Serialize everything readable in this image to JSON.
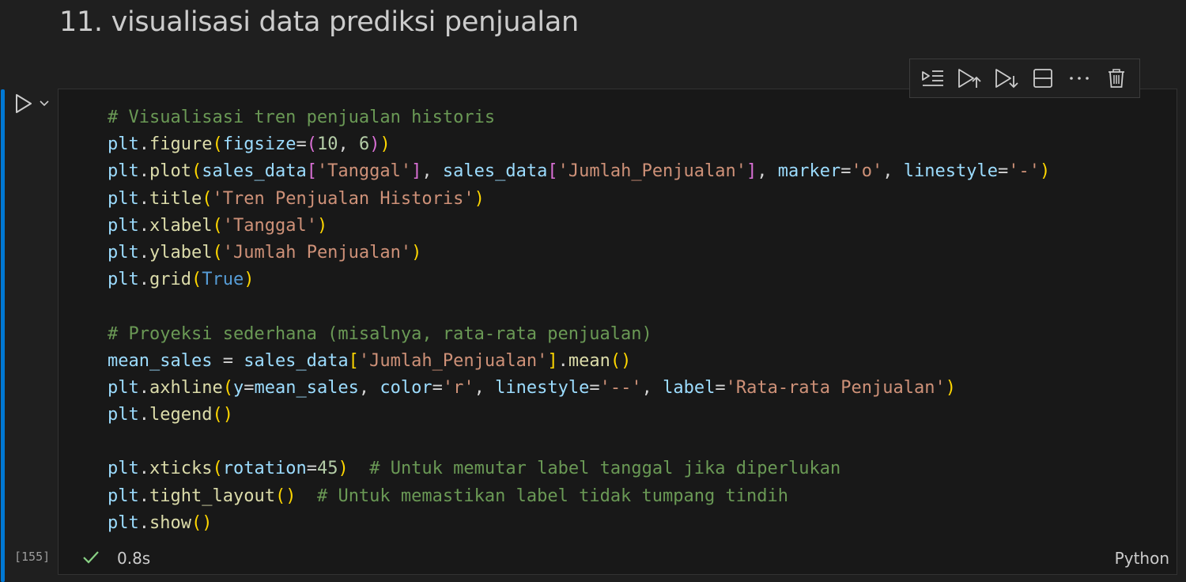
{
  "markdown": {
    "heading": "11. visualisasi data prediksi penjualan"
  },
  "cell": {
    "execution_count": "[155]",
    "duration": "0.8s",
    "language": "Python",
    "status": "success",
    "code_lines": [
      "# Visualisasi tren penjualan historis",
      "plt.figure(figsize=(10, 6))",
      "plt.plot(sales_data['Tanggal'], sales_data['Jumlah_Penjualan'], marker='o', linestyle='-')",
      "plt.title('Tren Penjualan Historis')",
      "plt.xlabel('Tanggal')",
      "plt.ylabel('Jumlah Penjualan')",
      "plt.grid(True)",
      "",
      "# Proyeksi sederhana (misalnya, rata-rata penjualan)",
      "mean_sales = sales_data['Jumlah_Penjualan'].mean()",
      "plt.axhline(y=mean_sales, color='r', linestyle='--', label='Rata-rata Penjualan')",
      "plt.legend()",
      "",
      "plt.xticks(rotation=45)  # Untuk memutar label tanggal jika diperlukan",
      "plt.tight_layout()  # Untuk memastikan label tidak tumpang tindih",
      "plt.show()"
    ]
  },
  "toolbar": {
    "buttons": [
      {
        "name": "execute-above-and-cell-icon"
      },
      {
        "name": "execute-cell-and-above-icon"
      },
      {
        "name": "execute-cell-and-below-icon"
      },
      {
        "name": "split-cell-icon"
      },
      {
        "name": "more-actions-icon"
      },
      {
        "name": "delete-cell-icon"
      }
    ]
  },
  "colors": {
    "background": "#1f1f1f",
    "editor_background": "#181818",
    "focus_bar": "#0078d4",
    "comment": "#6a9955",
    "variable": "#9cdcfe",
    "function": "#dcdcaa",
    "string": "#ce9178",
    "number": "#b5cea8",
    "keyword": "#569cd6",
    "bracket_level1": "#ffd700",
    "bracket_level2": "#da70d6",
    "bracket_level3": "#179fff",
    "success_check": "#89d185"
  }
}
